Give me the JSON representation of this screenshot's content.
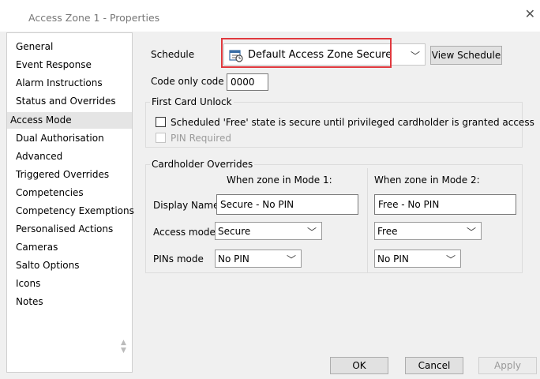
{
  "window": {
    "title": "Access Zone 1 - Properties",
    "close_glyph": "✕"
  },
  "sidebar": {
    "items": [
      {
        "label": "General"
      },
      {
        "label": "Event Response"
      },
      {
        "label": "Alarm Instructions"
      },
      {
        "label": "Status and Overrides"
      },
      {
        "label": "Access Mode"
      },
      {
        "label": "Dual Authorisation"
      },
      {
        "label": "Advanced"
      },
      {
        "label": "Triggered Overrides"
      },
      {
        "label": "Competencies"
      },
      {
        "label": "Competency Exemptions"
      },
      {
        "label": "Personalised Actions"
      },
      {
        "label": "Cameras"
      },
      {
        "label": "Salto Options"
      },
      {
        "label": "Icons"
      },
      {
        "label": "Notes"
      }
    ],
    "selected": "Access Mode",
    "scroll_arrows": "▲ ▼"
  },
  "schedule": {
    "label": "Schedule",
    "value": "Default Access Zone Secure",
    "icon": "schedule-calendar-icon",
    "view_button": "View Schedule",
    "highlight_color": "#e0393e"
  },
  "code_only": {
    "label": "Code only code",
    "value": "0000"
  },
  "first_card_unlock": {
    "title": "First Card Unlock",
    "scheduled_free_label": "Scheduled 'Free' state is secure until privileged cardholder is granted access",
    "scheduled_free_checked": false,
    "pin_required_label": "PIN Required",
    "pin_required_checked": false
  },
  "cardholder_overrides": {
    "title": "Cardholder Overrides",
    "mode1_header": "When zone in Mode 1:",
    "mode2_header": "When zone in Mode 2:",
    "display_name_label": "Display Name",
    "access_mode_label": "Access mode",
    "pins_mode_label": "PINs mode",
    "mode1": {
      "display_name": "Secure - No PIN",
      "access_mode": "Secure",
      "pins_mode": "No PIN"
    },
    "mode2": {
      "display_name": "Free - No PIN",
      "access_mode": "Free",
      "pins_mode": "No PIN"
    }
  },
  "footer": {
    "ok": "OK",
    "cancel": "Cancel",
    "apply": "Apply"
  },
  "chevron_glyph": "﹀"
}
